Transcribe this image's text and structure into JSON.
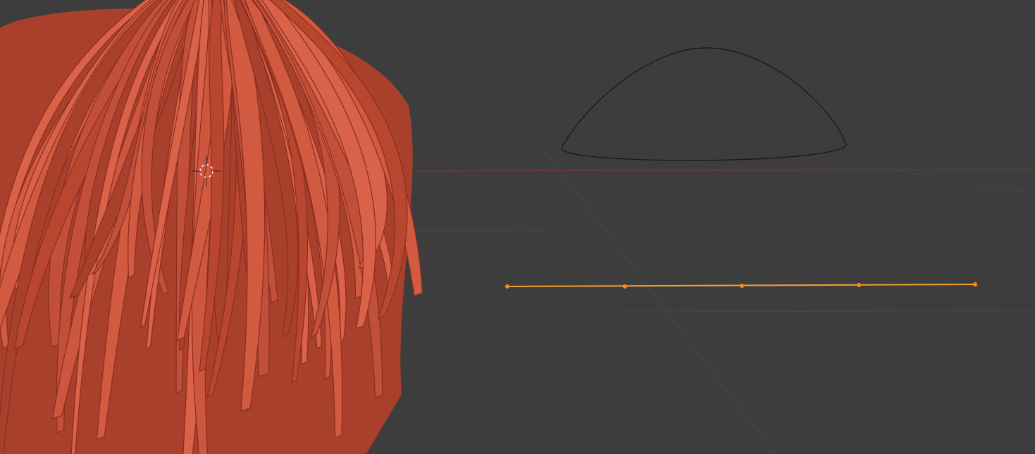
{
  "viewport": {
    "background": "#3d3d3d",
    "grid_color": "#474747",
    "grid_minor_color": "#434343",
    "x_axis_color": "#7a3a3a",
    "y_axis_color": "#5f6b2e"
  },
  "objects": {
    "hair_mesh": {
      "label": "",
      "base_color": "#c4513c",
      "highlight_color": "#d96249",
      "shadow_color": "#8e2f20",
      "neck_color": "#d9d9d9"
    },
    "dome_curve": {
      "label": "",
      "stroke_color": "#151515"
    },
    "selected_curve": {
      "label": "",
      "stroke_color": "#f4a12a",
      "point_color": "#ff8a18",
      "point_count": 5
    }
  },
  "icons": {
    "cursor": "3d-cursor-icon"
  }
}
